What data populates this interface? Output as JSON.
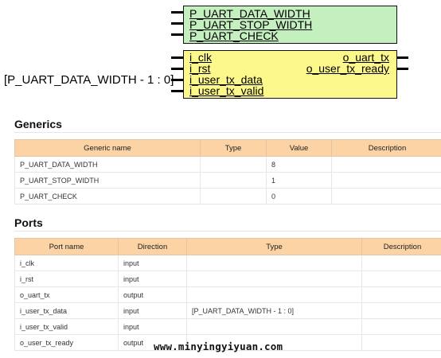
{
  "symbol": {
    "generic_lines": [
      "P_UART_DATA_WIDTH",
      "P_UART_STOP_WIDTH",
      "P_UART_CHECK"
    ],
    "input_ports": [
      "i_clk",
      "i_rst",
      "i_user_tx_data",
      "i_user_tx_valid"
    ],
    "output_ports": [
      "o_uart_tx",
      "o_user_tx_ready"
    ],
    "external_label": "[P_UART_DATA_WIDTH - 1 : 0]",
    "generics_fill": "#c4efbe",
    "ports_fill": "#fdf88c"
  },
  "generics": {
    "title": "Generics",
    "headers": [
      "Generic name",
      "Type",
      "Value",
      "Description"
    ],
    "rows": [
      [
        "P_UART_DATA_WIDTH",
        "",
        "8",
        ""
      ],
      [
        "P_UART_STOP_WIDTH",
        "",
        "1",
        ""
      ],
      [
        "P_UART_CHECK",
        "",
        "0",
        ""
      ]
    ]
  },
  "ports": {
    "title": "Ports",
    "headers": [
      "Port name",
      "Direction",
      "Type",
      "Description"
    ],
    "rows": [
      [
        "i_clk",
        "input",
        "",
        ""
      ],
      [
        "i_rst",
        "input",
        "",
        ""
      ],
      [
        "o_uart_tx",
        "output",
        "",
        ""
      ],
      [
        "i_user_tx_data",
        "input",
        "[P_UART_DATA_WIDTH - 1 : 0]",
        ""
      ],
      [
        "i_user_tx_valid",
        "input",
        "",
        ""
      ],
      [
        "o_user_tx_ready",
        "output",
        "",
        ""
      ]
    ]
  },
  "watermark": "www.minyingyiyuan.com",
  "table_header_color": "#fbd3a4"
}
